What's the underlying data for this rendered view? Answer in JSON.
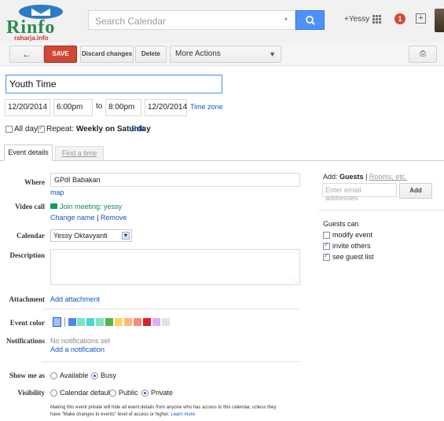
{
  "header": {
    "logo_text": "Rinfo",
    "logo_subtext": "raharja.info",
    "search_placeholder": "Search Calendar",
    "user": "+Yessy",
    "notification_count": "1"
  },
  "toolbar": {
    "back_icon": "←",
    "save": "SAVE",
    "discard": "Discard changes",
    "delete": "Delete",
    "more_actions": "More Actions",
    "print_icon": "⎙"
  },
  "event": {
    "title": "Youth Time",
    "start_date": "12/20/2014",
    "start_time": "6:00pm",
    "to": "to",
    "end_time": "8:00pm",
    "end_date": "12/20/2014",
    "time_zone": "Time zone",
    "all_day_label": "All day",
    "all_day_checked": false,
    "repeat_checked": true,
    "repeat_prefix": "Repeat:",
    "repeat_value": "Weekly on Saturday",
    "repeat_edit": "Edit"
  },
  "tabs": {
    "event_details": "Event details",
    "find_time": "Find a time"
  },
  "form": {
    "where_label": "Where",
    "where_value": "GPdI Babakan",
    "map_link": "map",
    "video_label": "Video call",
    "join_link": "Join meeting: yessy",
    "change_name": "Change name",
    "separator": "|",
    "remove": "Remove",
    "calendar_label": "Calendar",
    "calendar_value": "Yessy Oktavyanti",
    "description_label": "Description",
    "attachment_label": "Attachment",
    "add_attachment": "Add attachment",
    "event_color_label": "Event color",
    "colors": [
      "#a4bdfc",
      "#5484ed",
      "#7ae7bf",
      "#46d6db",
      "#7ae7bf",
      "#51b749",
      "#fbd75b",
      "#ffb878",
      "#ff887c",
      "#dc2127",
      "#dbadff",
      "#e1e1e1"
    ],
    "notifications_label": "Notifications",
    "no_notifications": "No notifications set",
    "add_notification": "Add a notification",
    "show_me_as_label": "Show me as",
    "available": "Available",
    "busy": "Busy",
    "visibility_label": "Visibility",
    "calendar_default": "Calendar default",
    "public": "Public",
    "private": "Private",
    "privacy_note_1": "Making this event private will hide all event details from anyone who has access to this calendar, unless they",
    "privacy_note_2": "have \"Make changes to events\" level of access or higher.",
    "learn_more": "Learn more"
  },
  "guests": {
    "add_prefix": "Add:",
    "add_guests": "Guests",
    "separator": "|",
    "rooms": "Rooms, etc.",
    "input_placeholder": "Enter email addresses",
    "add_button": "Add",
    "guests_can": "Guests can",
    "modify_event": "modify event",
    "invite_others": "invite others",
    "see_guest_list": "see guest list"
  }
}
